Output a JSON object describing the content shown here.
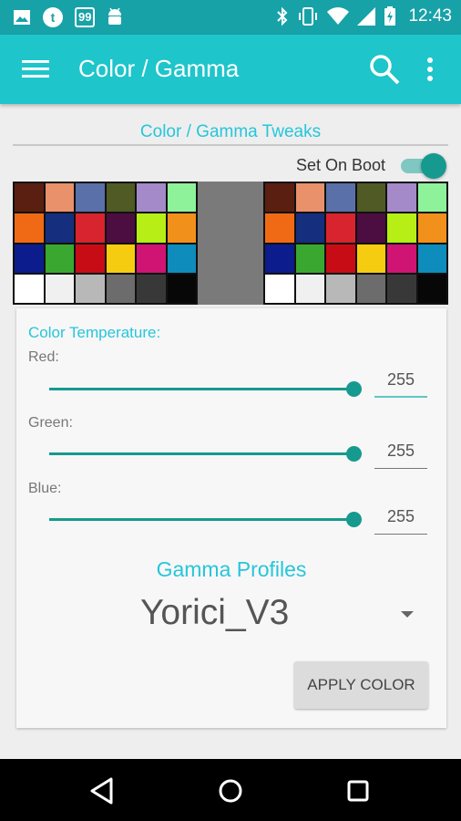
{
  "status_bar": {
    "left_icons": [
      "image-icon",
      "tumblr-icon",
      "badge-99-icon",
      "android-icon"
    ],
    "badge_text": "99",
    "right_icons": [
      "bluetooth-icon",
      "vibrate-icon",
      "wifi-icon",
      "signal-icon",
      "battery-charging-icon"
    ],
    "time": "12:43"
  },
  "app_bar": {
    "title": "Color / Gamma",
    "color": "#1ec5cb"
  },
  "main": {
    "section_title": "Color / Gamma Tweaks",
    "set_on_boot": {
      "label": "Set On Boot",
      "checked": true
    }
  },
  "color_chart": {
    "colors": [
      "#5a1f10",
      "#e8916a",
      "#5a70a8",
      "#4f5a24",
      "#a48ac8",
      "#8ef29a",
      "#f06a16",
      "#162e7e",
      "#d8242e",
      "#4c0d40",
      "#b6ee16",
      "#f2901c",
      "#0c1c8c",
      "#3aa830",
      "#c80c16",
      "#f6cc10",
      "#d01474",
      "#0e8cbc",
      "#ffffff",
      "#f0f0f0",
      "#b8b8b8",
      "#6c6c6c",
      "#383838",
      "#070707"
    ]
  },
  "color_temperature": {
    "label": "Color Temperature:",
    "channels": [
      {
        "name": "Red:",
        "value": "255",
        "level": 1.0
      },
      {
        "name": "Green:",
        "value": "255",
        "level": 1.0
      },
      {
        "name": "Blue:",
        "value": "255",
        "level": 1.0
      }
    ]
  },
  "gamma": {
    "title": "Gamma Profiles",
    "selected": "Yorici_V3"
  },
  "apply_button": "APPLY COLOR",
  "nav_bar": {
    "icons": [
      "back-icon",
      "home-icon",
      "recents-icon"
    ]
  },
  "colors": {
    "accent": "#26c6da",
    "slider": "#169a8f",
    "status_bar": "#17a2a8"
  }
}
